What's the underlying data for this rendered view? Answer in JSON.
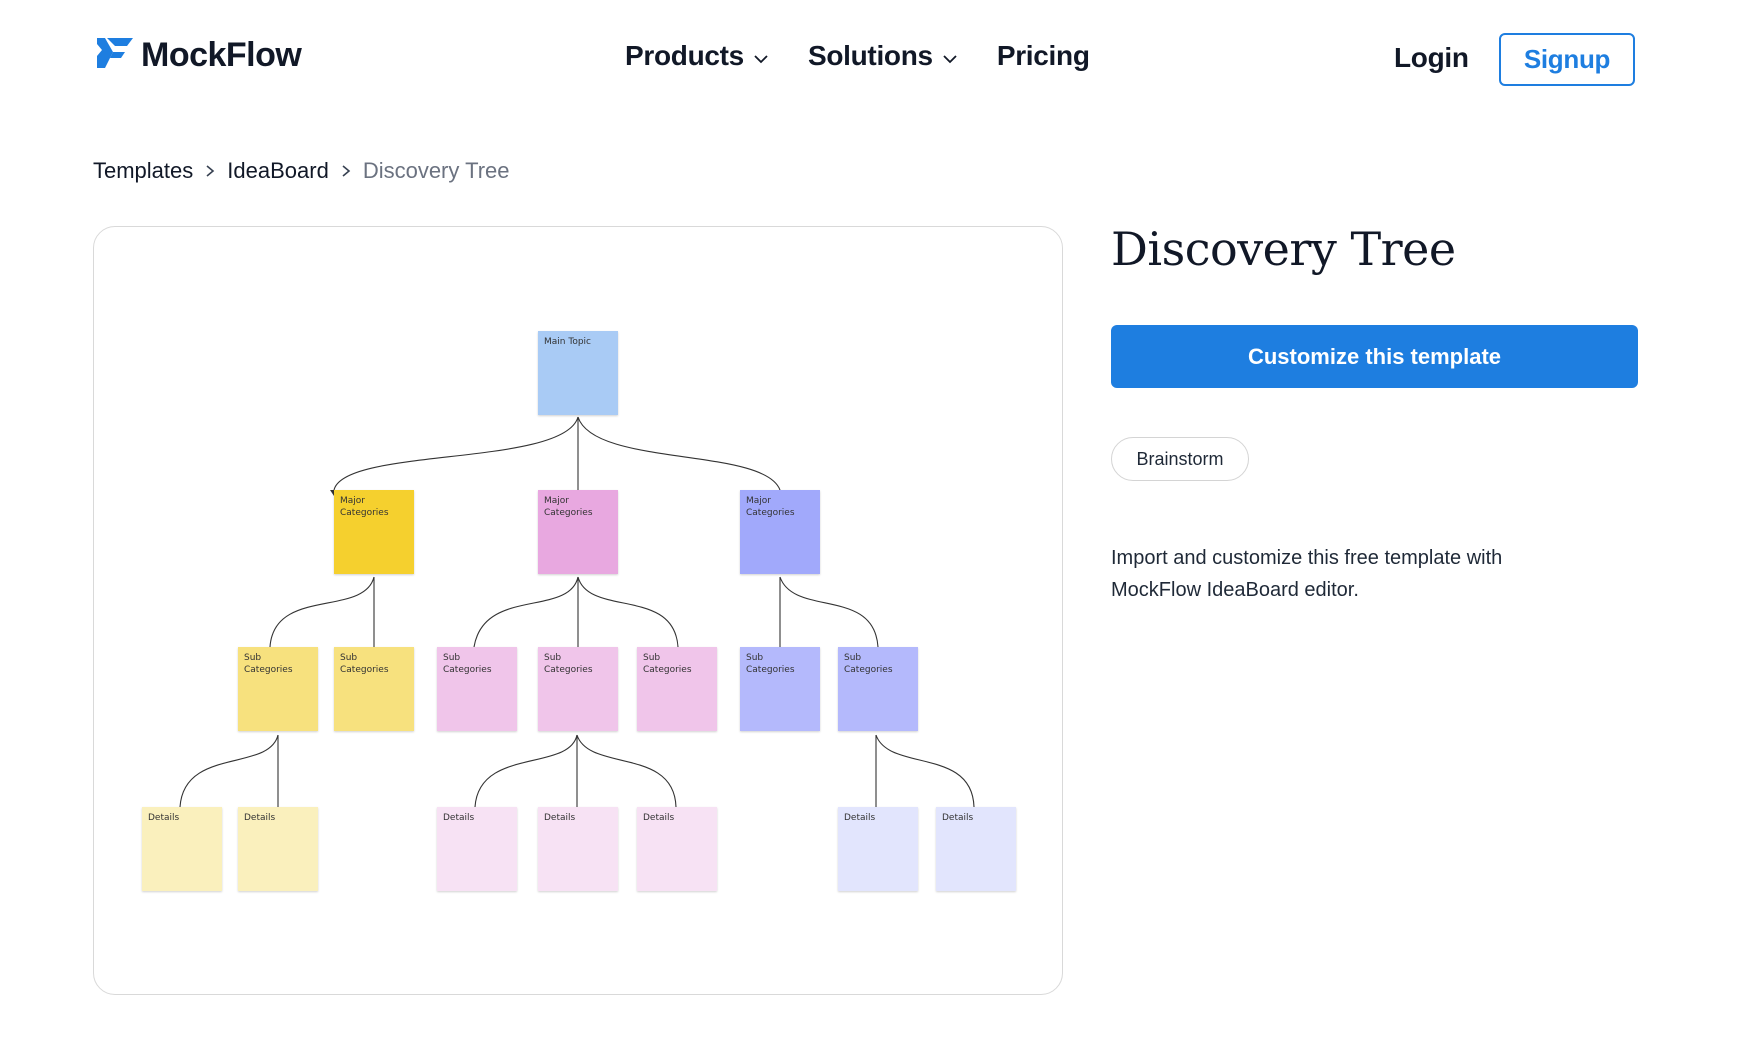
{
  "header": {
    "logo_text": "MockFlow",
    "nav": [
      {
        "label": "Products",
        "has_dropdown": true
      },
      {
        "label": "Solutions",
        "has_dropdown": true
      },
      {
        "label": "Pricing",
        "has_dropdown": false
      }
    ],
    "login_label": "Login",
    "signup_label": "Signup"
  },
  "breadcrumb": {
    "items": [
      "Templates",
      "IdeaBoard",
      "Discovery Tree"
    ]
  },
  "template": {
    "title": "Discovery Tree",
    "cta_label": "Customize this template",
    "tag": "Brainstorm",
    "description": "Import and customize this free template with MockFlow IdeaBoard editor."
  },
  "preview": {
    "notes": {
      "main": "Main Topic",
      "major": [
        "Major Categories",
        "Major Categories",
        "Major Categories"
      ],
      "sub": [
        "Sub Categories",
        "Sub Categories",
        "Sub Categories",
        "Sub Categories",
        "Sub Categories",
        "Sub Categories",
        "Sub Categories"
      ],
      "details": [
        "Details",
        "Details",
        "Details",
        "Details",
        "Details",
        "Details",
        "Details"
      ]
    }
  },
  "colors": {
    "accent": "#1e7ee0",
    "blue_note": "#a9cbf5",
    "yellow_dark": "#f5d02e",
    "yellow_mid": "#f7e17e",
    "yellow_light": "#faf0bd",
    "pink_dark": "#e8a8e0",
    "pink_mid": "#f0c5ea",
    "pink_light": "#f7e2f4",
    "purple_dark": "#a1a9fb",
    "purple_mid": "#b4b9fc",
    "purple_light": "#e2e5fd"
  }
}
